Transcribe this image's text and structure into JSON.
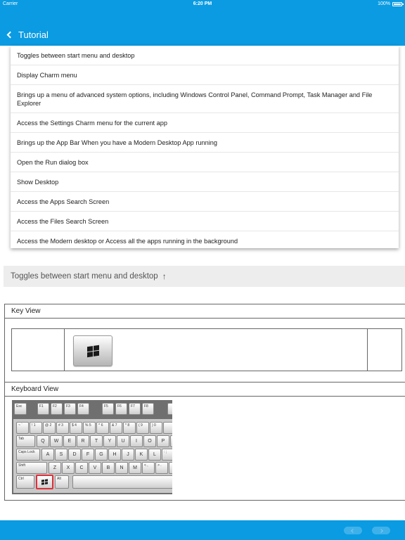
{
  "status_bar": {
    "carrier": "Carrier",
    "time": "6:20 PM",
    "battery": "100%"
  },
  "nav": {
    "back_label": "Tutorial"
  },
  "dropdown_items": [
    "Toggles between start menu and desktop",
    "Display Charm menu",
    "Brings up a menu of advanced system options, including Windows Control Panel, Command Prompt, Task Manager and File Explorer",
    "Access the Settings Charm menu for the current app",
    "Brings up the App Bar When you have a Modern Desktop App running",
    "Open the Run dialog box",
    "Show Desktop",
    "Access the Apps Search Screen",
    "Access the Files Search Screen",
    "Access the Modern desktop or Access all the apps running in the background"
  ],
  "selected": {
    "text": "Toggles between start menu and desktop"
  },
  "table": {
    "key_view_label": "Key View",
    "keyboard_view_label": "Keyboard View"
  },
  "keyboard": {
    "fn_row": [
      "Esc",
      "F1",
      "F2",
      "F3",
      "F4",
      "F5",
      "F6",
      "F7",
      "F8"
    ],
    "num_row": [
      "~ `",
      "! 1",
      "@ 2",
      "# 3",
      "$ 4",
      "% 5",
      "^ 6",
      "& 7",
      "* 8",
      "( 9",
      ") 0"
    ],
    "qwerty_row": [
      "Q",
      "W",
      "E",
      "R",
      "T",
      "Y",
      "U",
      "I",
      "O",
      "P"
    ],
    "home_row": [
      "A",
      "S",
      "D",
      "F",
      "G",
      "H",
      "J",
      "K",
      "L"
    ],
    "home_punct": [
      ": ;",
      "\" '"
    ],
    "bottom_row": [
      "Z",
      "X",
      "C",
      "V",
      "B",
      "N",
      "M"
    ],
    "bottom_punct": [
      "< ,",
      "> ."
    ],
    "tab_label": "Tab",
    "caps_label": "Caps Lock",
    "shift_label": "Shift",
    "ctrl_label": "Ctrl",
    "alt_label": "Alt"
  },
  "colors": {
    "accent": "#0a9be2",
    "highlight": "#e0303a"
  }
}
